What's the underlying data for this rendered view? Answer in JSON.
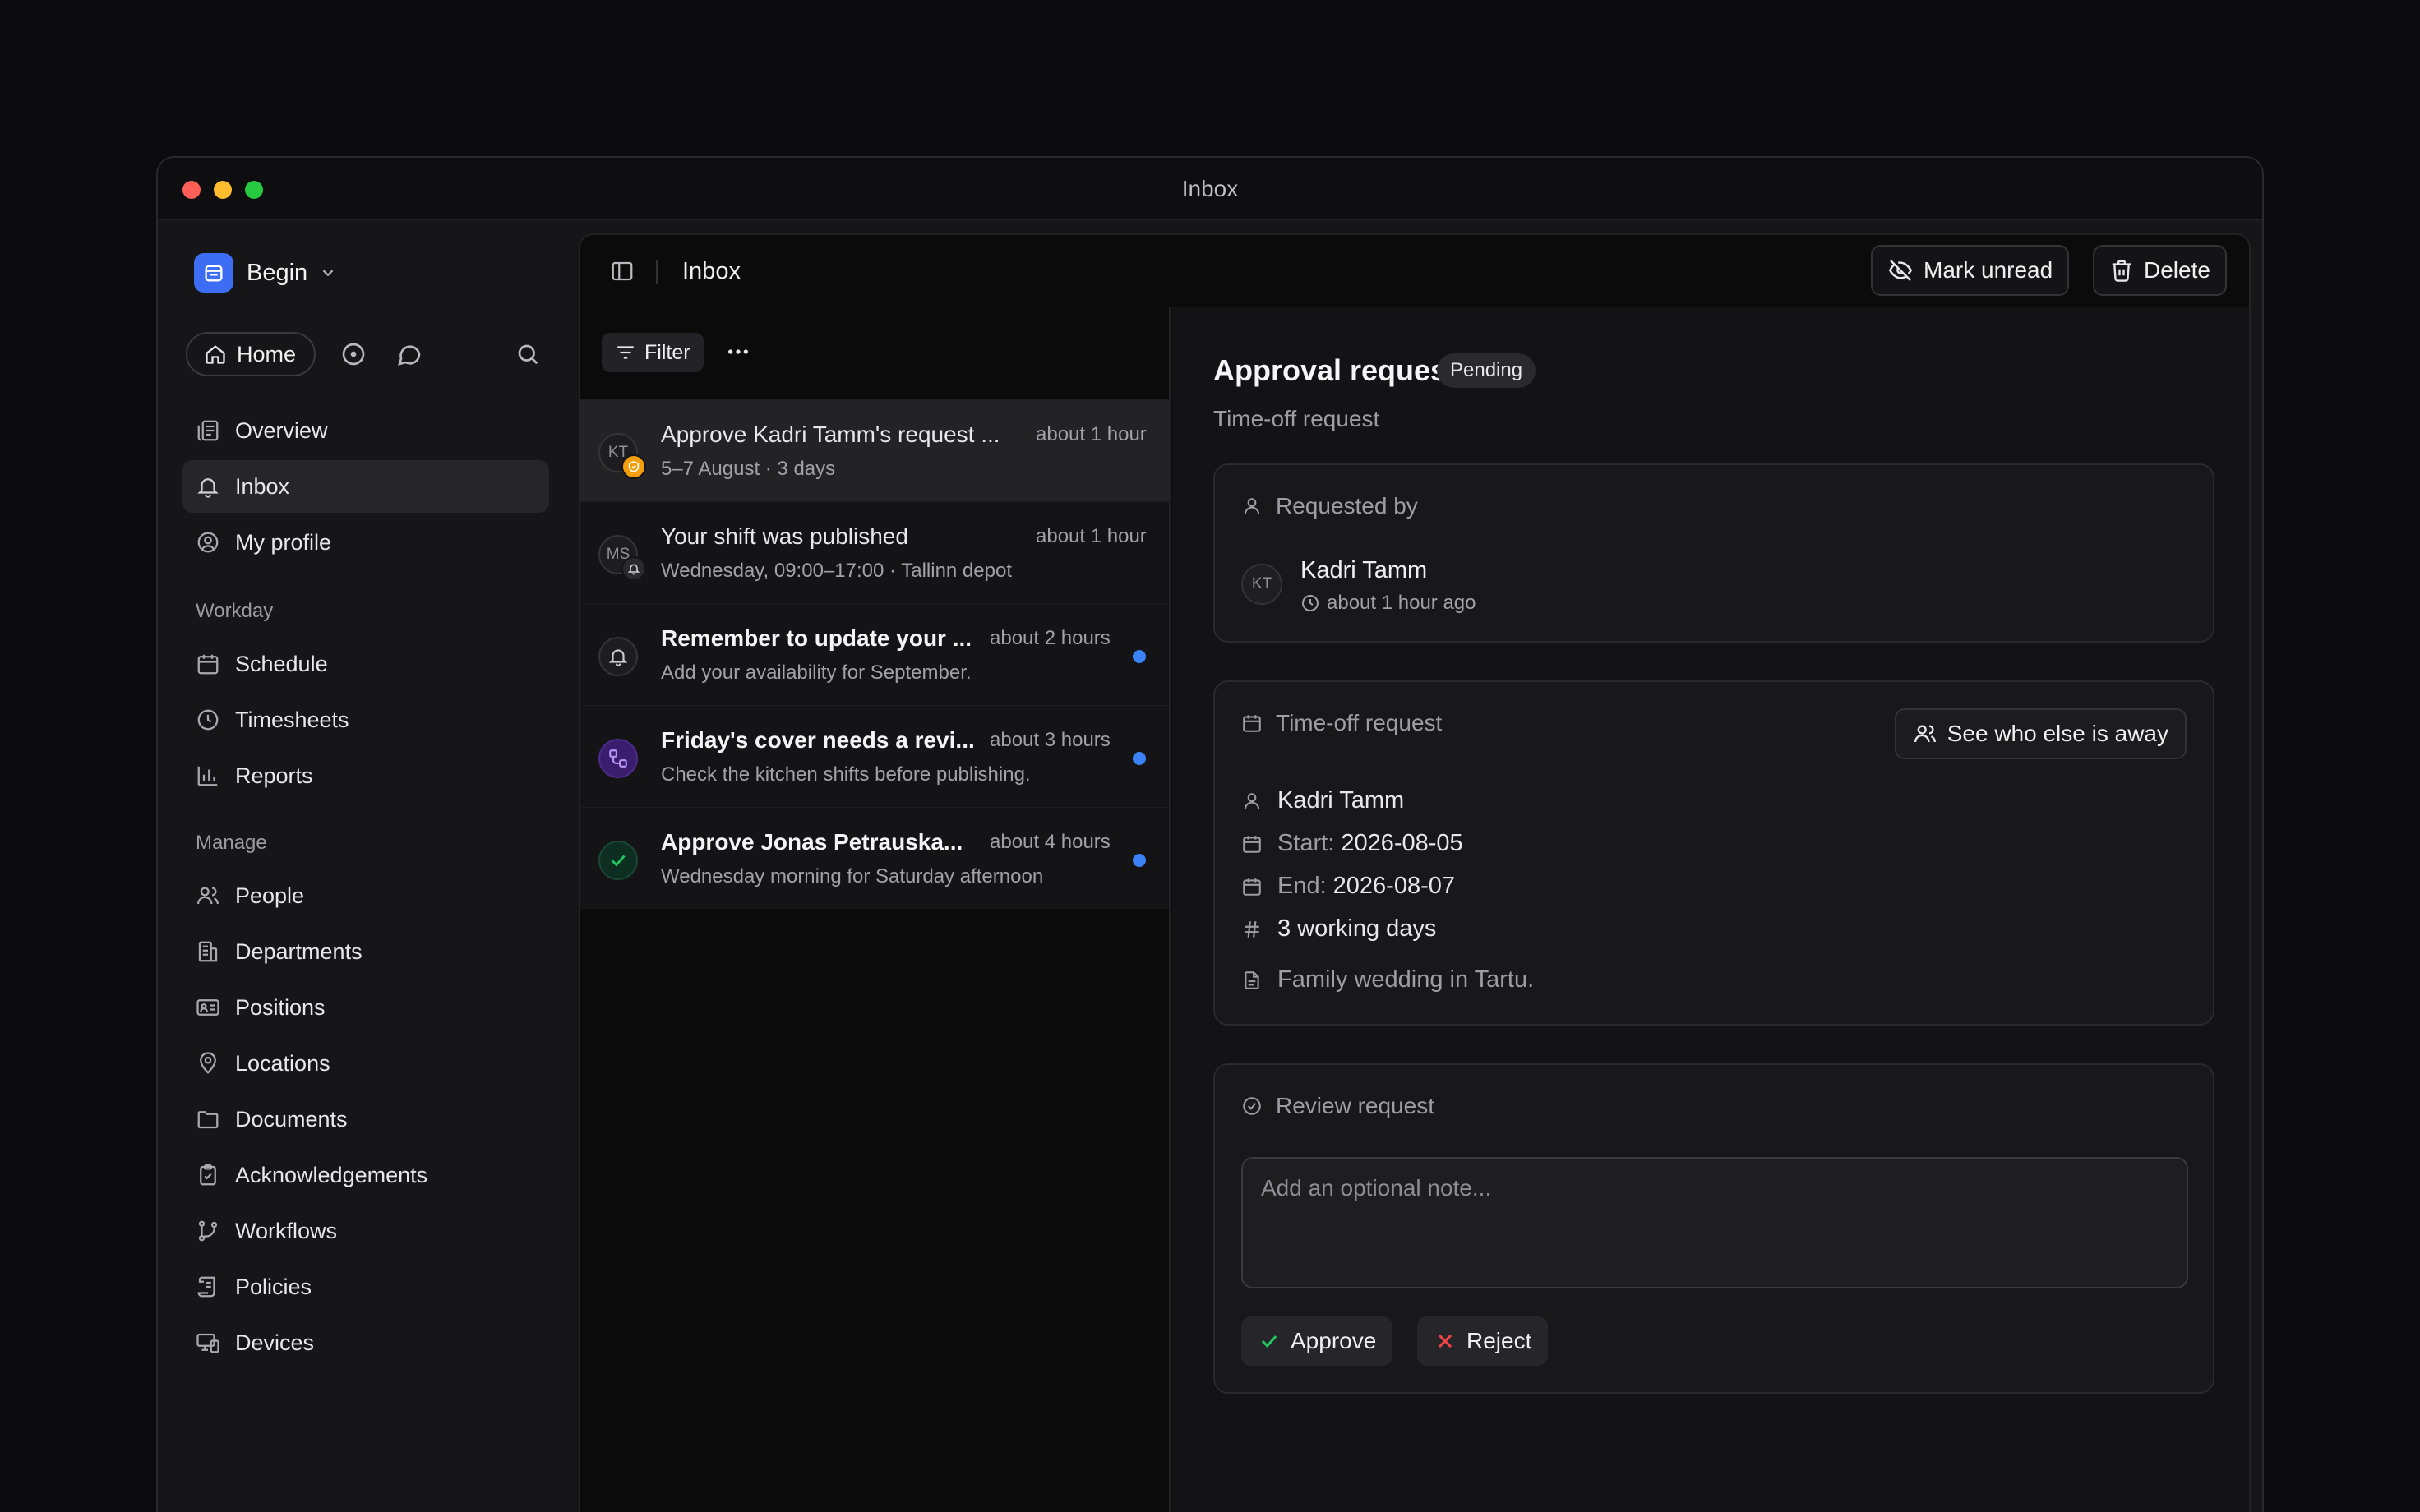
{
  "window": {
    "title": "Inbox"
  },
  "sidebar": {
    "workspace": "Begin",
    "home_label": "Home",
    "items_top": [
      {
        "label": "Overview",
        "icon": "overview-icon"
      },
      {
        "label": "Inbox",
        "icon": "bell-icon"
      },
      {
        "label": "My profile",
        "icon": "user-circle-icon"
      }
    ],
    "section_workday": "Workday",
    "items_workday": [
      {
        "label": "Schedule",
        "icon": "calendar-icon"
      },
      {
        "label": "Timesheets",
        "icon": "clock-icon"
      },
      {
        "label": "Reports",
        "icon": "bar-chart-icon"
      }
    ],
    "section_manage": "Manage",
    "items_manage": [
      {
        "label": "People",
        "icon": "people-icon"
      },
      {
        "label": "Departments",
        "icon": "building-icon"
      },
      {
        "label": "Positions",
        "icon": "id-card-icon"
      },
      {
        "label": "Locations",
        "icon": "map-pin-icon"
      },
      {
        "label": "Documents",
        "icon": "folder-icon"
      },
      {
        "label": "Acknowledgements",
        "icon": "clipboard-check-icon"
      },
      {
        "label": "Workflows",
        "icon": "git-branch-icon"
      },
      {
        "label": "Policies",
        "icon": "scroll-icon"
      },
      {
        "label": "Devices",
        "icon": "devices-icon"
      }
    ]
  },
  "toolbar": {
    "title": "Inbox",
    "mark_unread": "Mark unread",
    "delete": "Delete"
  },
  "list": {
    "filter_label": "Filter",
    "items": [
      {
        "initials": "KT",
        "title": "Approve Kadri Tamm's request ...",
        "subtitle": "5–7 August · 3 days",
        "time": "about 1 hour",
        "unread": false
      },
      {
        "initials": "MS",
        "title": "Your shift was published",
        "subtitle": "Wednesday, 09:00–17:00 · Tallinn depot",
        "time": "about 1 hour",
        "unread": false
      },
      {
        "initials": "",
        "title": "Remember to update your ...",
        "subtitle": "Add your availability for September.",
        "time": "about 2 hours",
        "unread": true
      },
      {
        "initials": "",
        "title": "Friday's cover needs a revi...",
        "subtitle": "Check the kitchen shifts before publishing.",
        "time": "about 3 hours",
        "unread": true
      },
      {
        "initials": "",
        "title": "Approve Jonas Petrauska...",
        "subtitle": "Wednesday morning for Saturday afternoon",
        "time": "about 4 hours",
        "unread": true
      }
    ]
  },
  "detail": {
    "title": "Approval request",
    "status": "Pending",
    "subtitle": "Time-off request",
    "requested_by": {
      "heading": "Requested by",
      "initials": "KT",
      "name": "Kadri Tamm",
      "time": "about 1 hour ago"
    },
    "timeoff": {
      "heading": "Time-off request",
      "see_away": "See who else is away",
      "person": "Kadri Tamm",
      "start_label": "Start:",
      "start": "2026-08-05",
      "end_label": "End:",
      "end": "2026-08-07",
      "days": "3 working days",
      "reason": "Family wedding in Tartu."
    },
    "review": {
      "heading": "Review request",
      "placeholder": "Add an optional note...",
      "approve": "Approve",
      "reject": "Reject"
    }
  },
  "colors": {
    "accent_blue": "#3b82f6",
    "approve_green": "#22c55e",
    "reject_red": "#ef4444",
    "badge_orange": "#f59e0b",
    "badge_purple": "#7c3aed"
  }
}
